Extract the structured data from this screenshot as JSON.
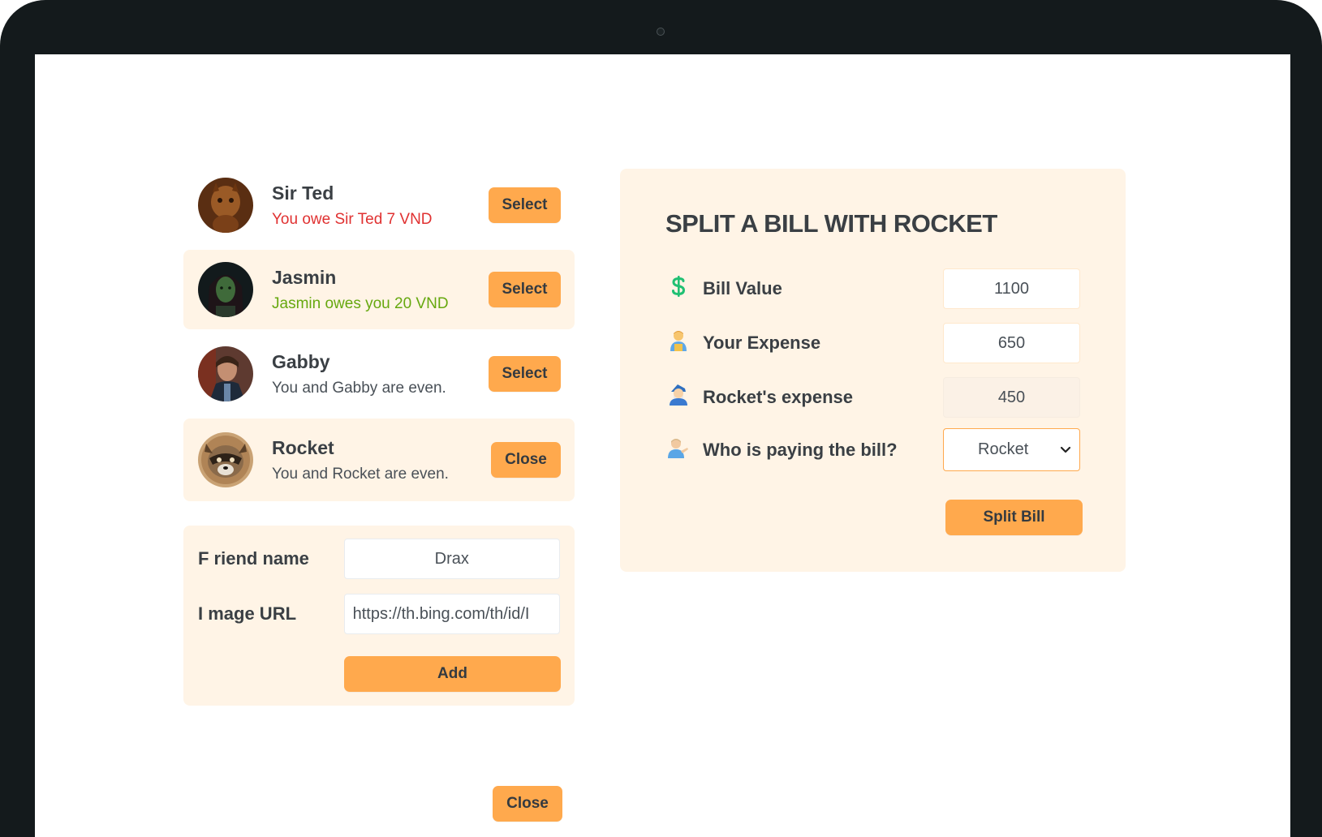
{
  "friends": [
    {
      "name": "Sir Ted",
      "status": "You owe Sir Ted 7 VND",
      "status_type": "owe",
      "button": "Select",
      "avatar_color": "#8a4a1e"
    },
    {
      "name": "Jasmin",
      "status": "Jasmin owes you 20 VND",
      "status_type": "owed",
      "button": "Select",
      "avatar_color": "#1b2a26"
    },
    {
      "name": "Gabby",
      "status": "You and Gabby are even.",
      "status_type": "even",
      "button": "Select",
      "avatar_color": "#3a2a2a"
    },
    {
      "name": "Rocket",
      "status": "You and Rocket are even.",
      "status_type": "even",
      "button": "Close",
      "selected": true,
      "avatar_color": "#6b5236"
    }
  ],
  "add_form": {
    "name_label": "F riend name",
    "name_value": "Drax",
    "image_label": "I mage URL",
    "image_value": "https://th.bing.com/th/id/I",
    "add_button": "Add"
  },
  "close_button": "Close",
  "bill": {
    "title": "SPLIT A BILL WITH ROCKET",
    "bill_value_label": "Bill Value",
    "bill_value": "1100",
    "your_expense_label": "Your Expense",
    "your_expense": "650",
    "friend_expense_label": "Rocket's expense",
    "friend_expense": "450",
    "payer_label": "Who is paying the bill?",
    "payer_value": "Rocket",
    "split_button": "Split Bill",
    "icons": {
      "bill_value": "dollar-icon",
      "your_expense": "person-icon",
      "friend_expense": "friend-person-icon",
      "payer": "pointing-person-icon"
    }
  },
  "colors": {
    "accent": "#ffa94d",
    "panel": "#fff4e6",
    "owe": "#e03131",
    "owed": "#66a80f",
    "frame": "#141a1c"
  }
}
